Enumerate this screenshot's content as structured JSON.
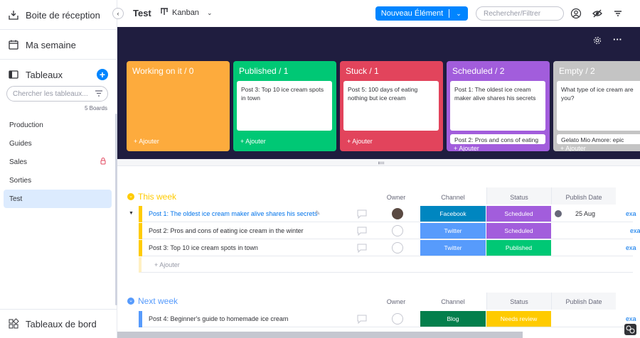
{
  "sidebar": {
    "inbox": "Boite de réception",
    "my_week": "Ma semaine",
    "boards_title": "Tableaux",
    "search_placeholder": "Chercher les tableaux...",
    "boards_count": "5 Boards",
    "boards": [
      {
        "label": "Production"
      },
      {
        "label": "Guides"
      },
      {
        "label": "Sales"
      },
      {
        "label": "Sorties"
      },
      {
        "label": "Test"
      }
    ],
    "dashboards": "Tableaux de bord"
  },
  "header": {
    "board_title": "Test",
    "view_label": "Kanban",
    "new_item": "Nouveau Élément",
    "search_placeholder": "Rechercher/Filtrer"
  },
  "kanban": {
    "columns": [
      {
        "title": "Working on it / 0",
        "color": "#fdab3d",
        "cards": [],
        "add": "+ Ajouter"
      },
      {
        "title": "Published / 1",
        "color": "#00c875",
        "cards": [
          "Post 3: Top 10 ice cream spots in town"
        ],
        "add": "+ Ajouter"
      },
      {
        "title": "Stuck / 1",
        "color": "#e2445c",
        "cards": [
          "Post 5: 100 days of eating nothing but ice cream"
        ],
        "add": "+ Ajouter"
      },
      {
        "title": "Scheduled / 2",
        "color": "#a25ddc",
        "cards": [
          "Post 1: The oldest ice cream maker alive shares his secrets",
          "Post 2: Pros and cons of eating"
        ],
        "add": "+ Ajouter"
      },
      {
        "title": "Empty / 2",
        "color": "#c4c4c4",
        "cards": [
          "What type of ice cream are you?",
          "Gelato Mio Amore: epic journey"
        ],
        "add": "+ Ajouter"
      }
    ]
  },
  "columns": {
    "owner": "Owner",
    "channel": "Channel",
    "status": "Status",
    "publish_date": "Publish Date"
  },
  "groups": [
    {
      "title": "This week",
      "color": "#ffcb00",
      "rows": [
        {
          "name": "Post 1: The oldest ice cream maker alive shares his secrets",
          "channel": "Facebook",
          "channel_color": "#0086c0",
          "status": "Scheduled",
          "status_color": "#a25ddc",
          "date": "25 Aug",
          "link": "exa"
        },
        {
          "name": "Post 2: Pros and cons of eating ice cream in the winter",
          "channel": "Twitter",
          "channel_color": "#579bfc",
          "status": "Scheduled",
          "status_color": "#a25ddc",
          "date": "",
          "link": "exa"
        },
        {
          "name": "Post 3: Top 10 ice cream spots in town",
          "channel": "Twitter",
          "channel_color": "#579bfc",
          "status": "Published",
          "status_color": "#00c875",
          "date": "",
          "link": "exa"
        }
      ],
      "add": "+ Ajouter"
    },
    {
      "title": "Next week",
      "color": "#579bfc",
      "rows": [
        {
          "name": "Post 4: Beginner's guide to homemade ice cream",
          "channel": "Blog",
          "channel_color": "#037f4c",
          "status": "Needs review",
          "status_color": "#ffcb00",
          "date": "",
          "link": "exa"
        }
      ]
    }
  ]
}
